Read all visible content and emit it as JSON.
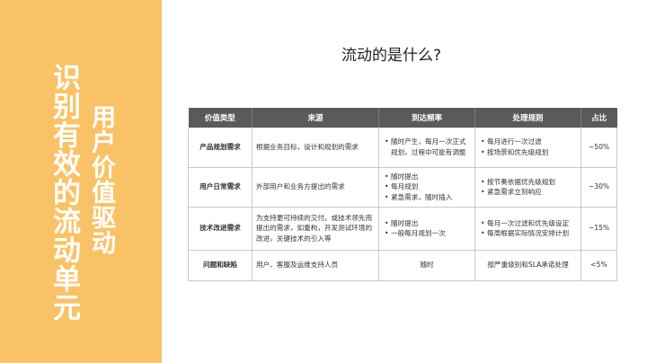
{
  "side": {
    "title_main": "识别有效的流动单元",
    "title_sub": "用户价值驱动"
  },
  "heading": "流动的是什么?",
  "table": {
    "headers": [
      "价值类型",
      "来源",
      "到达频率",
      "处理规则",
      "占比"
    ],
    "rows": [
      {
        "type": "产品规划需求",
        "source": "根据业务目标，设计和规划的需求",
        "frequency": [
          "随时产生，每月一次正式规划，过程中可能有调整"
        ],
        "rules": [
          "每月进行一次过滤",
          "按场景和优先级规划"
        ],
        "share": "~50%"
      },
      {
        "type": "用户日常需求",
        "source": "外部用户和业务方提出的需求",
        "frequency": [
          "随时提出",
          "每月规划",
          "紧急需求，随时插入"
        ],
        "rules": [
          "按节奏依据优先级规划",
          "紧急需求立刻响应"
        ],
        "share": "~30%"
      },
      {
        "type": "技术改进需求",
        "source": "为支持更可持续的交付，或技术领先而提出的需求，如重构，开发测试环境的改进，关键技术的引入等",
        "frequency": [
          "随时提出",
          "一般每月规划一次"
        ],
        "rules": [
          "每月一次过滤和优先级设定",
          "每周根据实际情况安排计划"
        ],
        "share": "~15%"
      },
      {
        "type": "问题和缺陷",
        "source": "用户、客服及运维支持人员",
        "frequency_text": "随时",
        "rules_text": "按严重级别和SLA承诺处理",
        "share": "<5%"
      }
    ]
  }
}
